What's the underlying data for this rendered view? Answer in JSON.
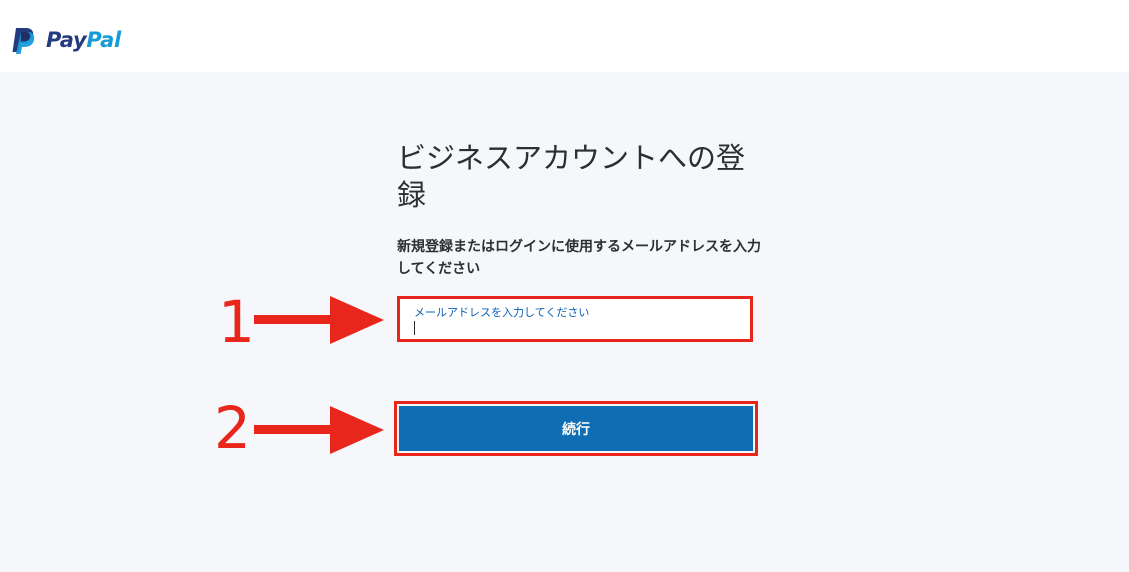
{
  "brand": {
    "logo_text_part1": "Pay",
    "logo_text_part2": "Pal",
    "logo_icon": "paypal-p-icon",
    "colors": {
      "dark_blue": "#253b80",
      "light_blue": "#179bd7"
    }
  },
  "page": {
    "title": "ビジネスアカウントへの登録",
    "instruction": "新規登録またはログインに使用するメールアドレスを入力してください"
  },
  "email_field": {
    "label": "メールアドレスを入力してください",
    "value": ""
  },
  "continue_button": {
    "label": "続行",
    "color": "#0f6db3"
  },
  "annotations": {
    "step1": "1",
    "step2": "2",
    "color": "#e8261c",
    "arrow_icon": "right-arrow-icon"
  }
}
